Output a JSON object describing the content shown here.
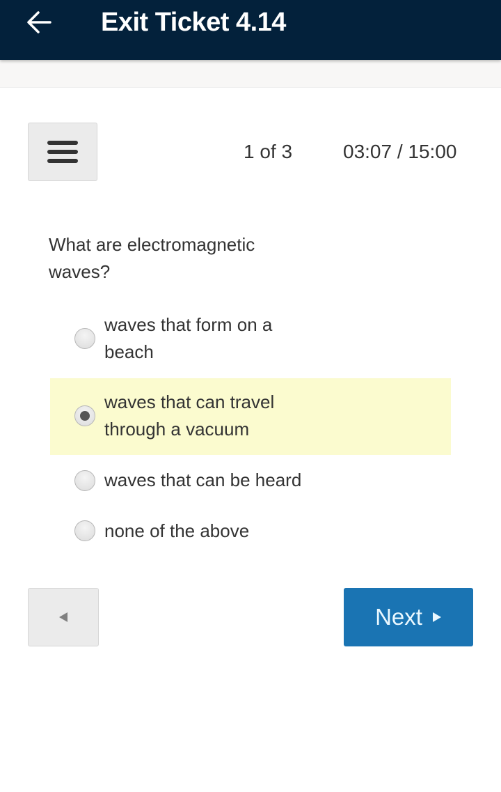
{
  "app_bar": {
    "title": "Exit Ticket 4.14",
    "back_icon": "arrow-left-icon",
    "background": "#03213b"
  },
  "toolbar": {
    "menu_icon": "hamburger-menu-icon",
    "progress": "1 of 3",
    "timer": "03:07 / 15:00",
    "timer_elapsed": "03:07",
    "timer_total": "15:00"
  },
  "question": {
    "text": "What are electromagnetic waves?",
    "options": [
      {
        "label": "waves that form on a beach",
        "selected": false
      },
      {
        "label": "waves that can travel through a vacuum",
        "selected": true
      },
      {
        "label": "waves that can be heard",
        "selected": false
      },
      {
        "label": "none of the above",
        "selected": false
      }
    ],
    "selected_index": 1,
    "selected_highlight_color": "#fbfbcf"
  },
  "navigation": {
    "prev_icon": "triangle-left-icon",
    "next_label": "Next",
    "next_icon": "triangle-right-icon",
    "next_color": "#1a74b3"
  }
}
